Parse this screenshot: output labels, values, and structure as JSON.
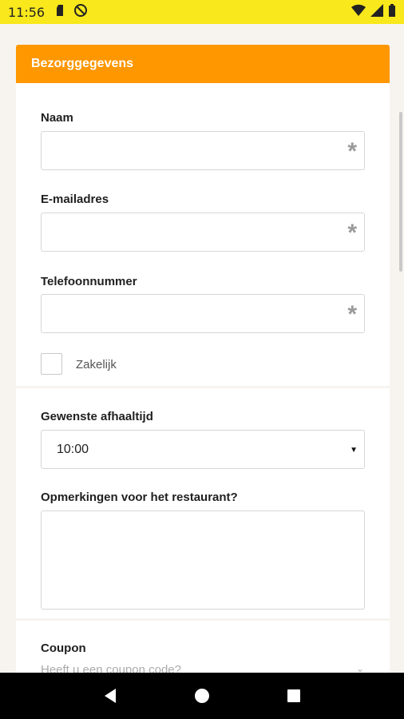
{
  "status_bar": {
    "time": "11:56",
    "icons": [
      "sd-card-icon",
      "no-disturb-icon",
      "wifi-icon",
      "signal-icon",
      "battery-icon"
    ]
  },
  "form": {
    "header_title": "Bezorggegevens",
    "fields": {
      "name_label": "Naam",
      "email_label": "E-mailadres",
      "phone_label": "Telefoonnummer",
      "required_mark": "*"
    },
    "business_checkbox_label": "Zakelijk",
    "pickup_time_label": "Gewenste afhaaltijd",
    "pickup_time_value": "10:00",
    "remarks_label": "Opmerkingen voor het restaurant?",
    "coupon_label": "Coupon",
    "coupon_placeholder": "Heeft u een coupon code?"
  },
  "colors": {
    "status_bar": "#f8e81c",
    "header": "#fe9700"
  }
}
